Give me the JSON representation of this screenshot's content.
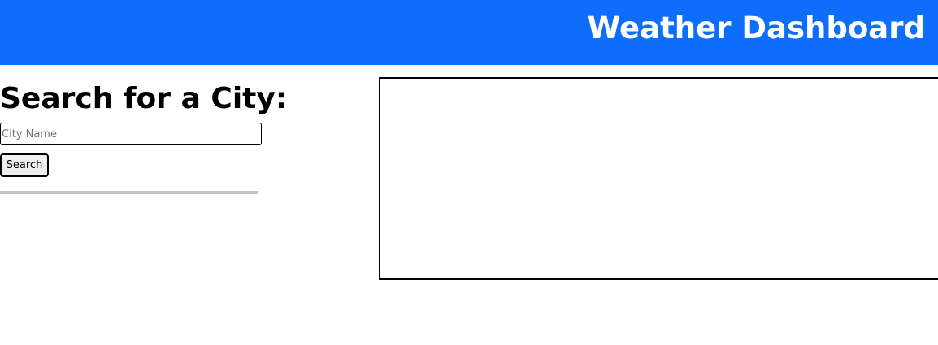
{
  "header": {
    "title": "Weather Dashboard",
    "background_color": "#0d6efd",
    "text_color": "#ffffff"
  },
  "search": {
    "heading": "Search for a City:",
    "input_value": "",
    "input_placeholder": "City Name",
    "button_label": "Search"
  },
  "history": {
    "items": []
  },
  "current_weather": {
    "content": ""
  }
}
